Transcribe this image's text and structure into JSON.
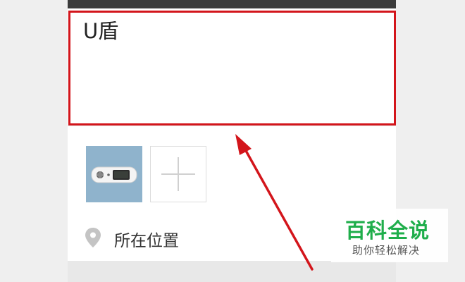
{
  "compose": {
    "text": "U盾"
  },
  "location": {
    "icon": "location-pin-icon",
    "label": "所在位置"
  },
  "photos": {
    "thumb_icon": "usb-key-photo",
    "add_icon": "plus-icon"
  },
  "annotation": {
    "box_color": "#d3151b",
    "arrow_color": "#d3151b"
  },
  "watermark": {
    "title": "百科全说",
    "subtitle": "助你轻松解决",
    "color": "#1fae4b"
  }
}
